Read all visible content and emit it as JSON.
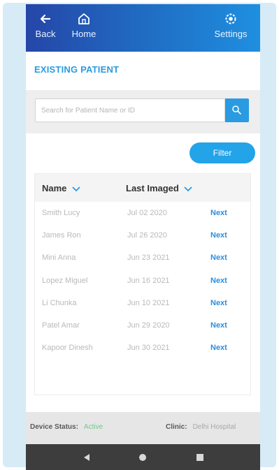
{
  "topbar": {
    "back_label": "Back",
    "home_label": "Home",
    "settings_label": "Settings",
    "colors": {
      "start": "#2546a8",
      "end": "#1f8fe0"
    }
  },
  "page": {
    "heading": "EXISTING PATIENT"
  },
  "search": {
    "placeholder": "Search for Patient Name or ID",
    "icon": "search-icon"
  },
  "filter": {
    "label": "Filter"
  },
  "table": {
    "columns": [
      "Name",
      "Last Imaged"
    ],
    "sort_icon": "chevron-down-icon",
    "rows": [
      {
        "name": "Smith Lucy",
        "date": "Jul 02 2020",
        "action": "Next"
      },
      {
        "name": "James Ron",
        "date": "Jul 26 2020",
        "action": "Next"
      },
      {
        "name": "Mini Anna",
        "date": "Jun 23 2021",
        "action": "Next"
      },
      {
        "name": "Lopez Miguel",
        "date": "Jun 16 2021",
        "action": "Next"
      },
      {
        "name": "Li Chunka",
        "date": "Jun 10 2021",
        "action": "Next"
      },
      {
        "name": "Patel Amar",
        "date": "Jun 29 2020",
        "action": "Next"
      },
      {
        "name": "Kapoor Dinesh",
        "date": "Jun 30 2021",
        "action": "Next"
      }
    ]
  },
  "status": {
    "device_label": "Device Status:",
    "device_value": "Active",
    "device_color": "#6fc88a",
    "clinic_label": "Clinic:",
    "clinic_value": "Delhi Hospital"
  },
  "system_nav": {
    "icons": [
      "back-triangle-icon",
      "home-circle-icon",
      "recents-square-icon"
    ]
  },
  "accent": "#2a9be0"
}
